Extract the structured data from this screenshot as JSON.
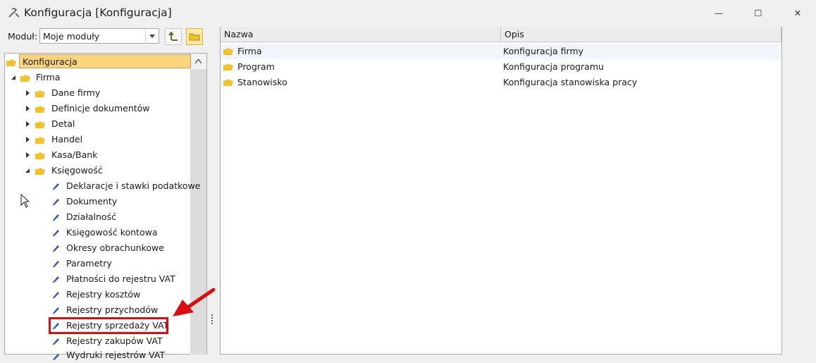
{
  "window": {
    "title": "Konfiguracja [Konfiguracja]",
    "controls": {
      "minimize": "—",
      "maximize": "☐",
      "close": "✕"
    }
  },
  "toolbar": {
    "module_label": "Moduł:",
    "module_value": "Moje moduły"
  },
  "tree": {
    "root": "Konfiguracja",
    "firma": "Firma",
    "children": [
      {
        "label": "Dane firmy"
      },
      {
        "label": "Definicje dokumentów"
      },
      {
        "label": "Detal"
      },
      {
        "label": "Handel"
      },
      {
        "label": "Kasa/Bank"
      },
      {
        "label": "Księgowość"
      }
    ],
    "ksiegowosc_items": [
      {
        "label": "Deklaracje i stawki podatkowe"
      },
      {
        "label": "Dokumenty"
      },
      {
        "label": "Działalność"
      },
      {
        "label": "Księgowość kontowa"
      },
      {
        "label": "Okresy obrachunkowe"
      },
      {
        "label": "Parametry"
      },
      {
        "label": "Płatności do rejestru VAT"
      },
      {
        "label": "Rejestry kosztów"
      },
      {
        "label": "Rejestry przychodów"
      },
      {
        "label": "Rejestry sprzedaży VAT"
      },
      {
        "label": "Rejestry zakupów VAT"
      },
      {
        "label": "Wydruki rejestrów VAT"
      }
    ]
  },
  "list": {
    "columns": [
      "Nazwa",
      "Opis"
    ],
    "rows": [
      {
        "name": "Firma",
        "desc": "Konfiguracja firmy"
      },
      {
        "name": "Program",
        "desc": "Konfiguracja programu"
      },
      {
        "name": "Stanowisko",
        "desc": "Konfiguracja stanowiska pracy"
      }
    ]
  },
  "colors": {
    "folder": "#f2c12e",
    "selection": "#fcd480",
    "highlight": "#d90f0f",
    "doc_icon": "#2e5fb0"
  }
}
